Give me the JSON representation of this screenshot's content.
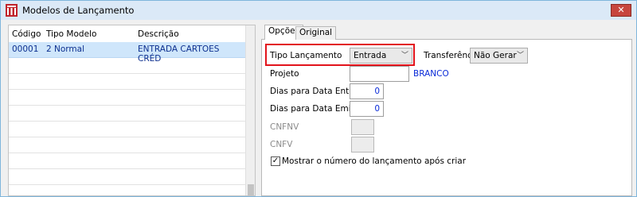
{
  "window": {
    "title": "Modelos de Lançamento",
    "close_glyph": "✕"
  },
  "grid": {
    "columns": [
      "Código",
      "Tipo Modelo",
      "Descrição"
    ],
    "rows": [
      {
        "codigo": "00001",
        "tipo": "2 Normal",
        "descricao": "ENTRADA CARTOES CRÉD"
      }
    ]
  },
  "tabs": [
    "Opções",
    "Original"
  ],
  "form": {
    "tipo_lancamento_label": "Tipo Lançamento",
    "tipo_lancamento_value": "Entrada",
    "transferencia_label": "Transferência",
    "transferencia_value": "Não Gerar",
    "projeto_label": "Projeto",
    "projeto_value": "",
    "projeto_desc": "BRANCO",
    "dias_entrada_label": "Dias para Data Entrada",
    "dias_entrada_value": "0",
    "dias_emissao_label": "Dias para Data Emissão",
    "dias_emissao_value": "0",
    "cnfnv_label": "CNFNV",
    "cnfv_label": "CNFV",
    "mostrar_label": "Mostrar o número do lançamento após criar",
    "mostrar_checked": true
  },
  "colors": {
    "highlight": "#e2131b",
    "selected_row": "#cfe6fb",
    "value_blue": "#0a2bd8"
  }
}
